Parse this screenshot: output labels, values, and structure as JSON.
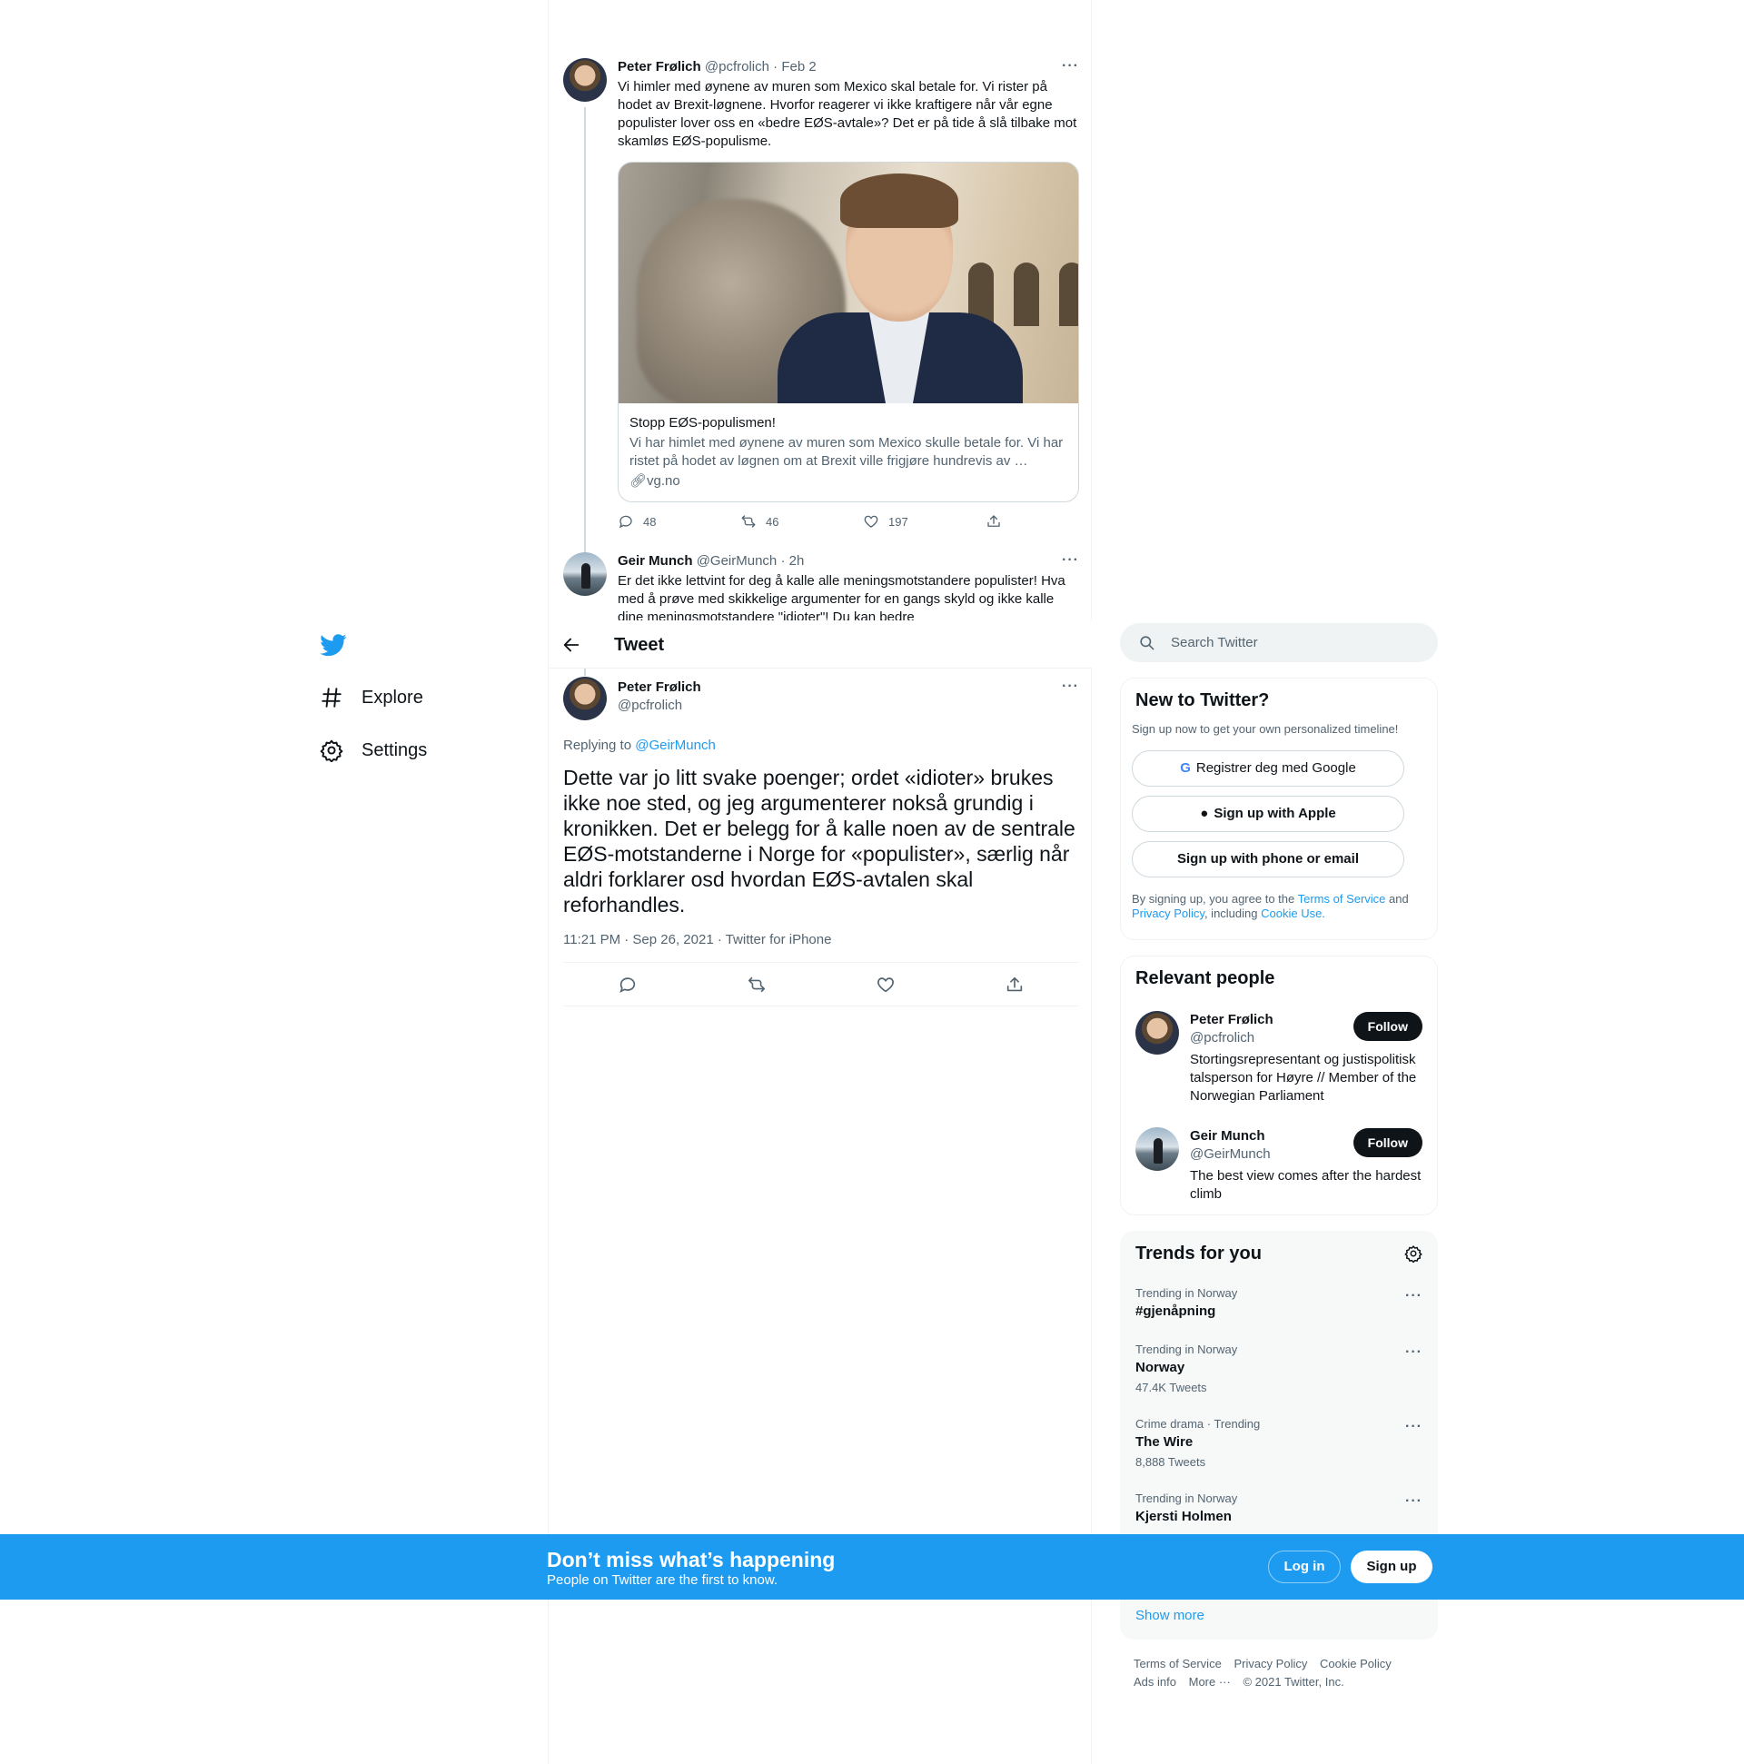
{
  "colors": {
    "brand": "#1d9bf0",
    "text": "#0f1419",
    "muted": "#536471"
  },
  "thread": [
    {
      "name": "Peter Frølich",
      "handle": "@pcfrolich",
      "time": "Feb 2",
      "text": "Vi himler med øynene av muren som Mexico skal betale for. Vi rister på hodet av Brexit-løgnene. Hvorfor reagerer vi ikke kraftigere når vår egne populister lover oss en «bedre EØS-avtale»? Det er på tide å slå tilbake mot skamløs EØS-populisme.",
      "card": {
        "title": "Stopp EØS-populismen!",
        "description": "Vi har himlet med øynene av muren som Mexico skulle betale for. Vi har ristet på hodet av løgnen om at Brexit ville frigjøre hundrevis av …",
        "domain": "vg.no"
      },
      "replies": "48",
      "retweets": "46",
      "likes": "197"
    },
    {
      "name": "Geir Munch",
      "handle": "@GeirMunch",
      "time": "2h",
      "text": "Er det ikke lettvint for deg å kalle alle meningsmotstandere populister! Hva med å prøve med skikkelige argumenter for en gangs skyld og ikke kalle dine meningsmotstandere \"idioter\"! Du kan bedre"
    }
  ],
  "header": {
    "title": "Tweet"
  },
  "focused": {
    "name": "Peter Frølich",
    "handle": "@pcfrolich",
    "replying_prefix": "Replying to ",
    "replying_to": "@GeirMunch",
    "text": "Dette var jo litt svake poenger; ordet «idioter» brukes ikke noe sted, og jeg argumenterer nokså grundig i kronikken. Det er belegg for å kalle noen av de sentrale EØS-motstanderne i Norge for «populister», særlig når aldri forklarer osd hvordan EØS-avtalen skal reforhandles.",
    "timestamp": "11:21 PM · Sep 26, 2021 · Twitter for iPhone"
  },
  "nav": {
    "explore": "Explore",
    "settings": "Settings"
  },
  "search": {
    "placeholder": "Search Twitter"
  },
  "new_to_twitter": {
    "title": "New to Twitter?",
    "subtitle": "Sign up now to get your own personalized timeline!",
    "google": "Registrer deg med Google",
    "apple": "Sign up with Apple",
    "phone": "Sign up with phone or email",
    "legal_1": "By signing up, you agree to the ",
    "terms": "Terms of Service",
    "legal_2": " and ",
    "privacy": "Privacy Policy",
    "legal_3": ", including ",
    "cookie": "Cookie Use."
  },
  "relevant": {
    "title": "Relevant people",
    "people": [
      {
        "name": "Peter Frølich",
        "handle": "@pcfrolich",
        "bio": "Stortingsrepresentant og justispolitisk talsperson for Høyre // Member of the Norwegian Parliament",
        "follow": "Follow"
      },
      {
        "name": "Geir Munch",
        "handle": "@GeirMunch",
        "bio": "The best view comes after the hardest climb",
        "follow": "Follow"
      }
    ]
  },
  "trends": {
    "title": "Trends for you",
    "items": [
      {
        "context": "Trending in Norway",
        "name": "#gjenåpning",
        "count": ""
      },
      {
        "context": "Trending in Norway",
        "name": "Norway",
        "count": "47.4K Tweets"
      },
      {
        "context": "Crime drama · Trending",
        "name": "The Wire",
        "count": "8,888 Tweets"
      },
      {
        "context": "Trending in Norway",
        "name": "Kjersti Holmen",
        "count": ""
      }
    ],
    "show_more": "Show more"
  },
  "footer": {
    "terms": "Terms of Service",
    "privacy": "Privacy Policy",
    "cookie": "Cookie Policy",
    "ads": "Ads info",
    "more": "More ···",
    "copyright": "© 2021 Twitter, Inc."
  },
  "banner": {
    "title": "Don’t miss what’s happening",
    "subtitle": "People on Twitter are the first to know.",
    "login": "Log in",
    "signup": "Sign up"
  }
}
